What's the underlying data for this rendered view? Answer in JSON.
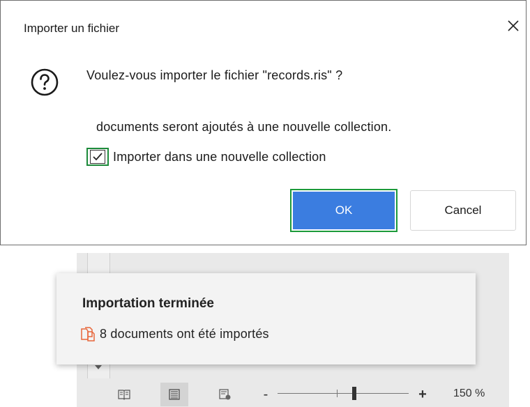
{
  "dialog": {
    "title": "Importer un fichier",
    "question": "Voulez-vous importer le fichier \"records.ris\" ?",
    "info": "documents seront ajoutés à une nouvelle collection.",
    "checkbox": {
      "label": "Importer dans une nouvelle collection",
      "checked": true
    },
    "ok_label": "OK",
    "cancel_label": "Cancel"
  },
  "notification": {
    "title": "Importation terminée",
    "message": "8 documents ont été importés",
    "icon": "documents-icon"
  },
  "statusbar": {
    "view_buttons": [
      "reading-view-icon",
      "page-view-icon",
      "web-view-icon"
    ],
    "active_view": "page-view-icon",
    "zoom_minus": "-",
    "zoom_plus": "+",
    "zoom_level": "150 %"
  },
  "colors": {
    "primary_button": "#3b7de0",
    "focus_outline": "#1c9a3a",
    "notification_icon": "#e8663a"
  }
}
